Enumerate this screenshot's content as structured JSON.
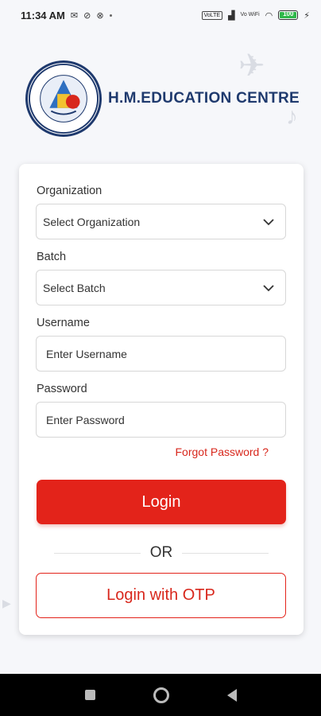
{
  "status_bar": {
    "time": "11:34 AM",
    "left_icons": [
      "mail-icon",
      "no-signal-icon",
      "block-icon"
    ],
    "right_icons": [
      "volte-icon",
      "sim-signal-icon",
      "wifi-label-icon",
      "wifi-icon",
      "battery-icon",
      "charging-icon"
    ],
    "volte_label": "VoLTE",
    "wifi_label": "Vo WiFi",
    "battery_level": "100"
  },
  "brand": {
    "title": "H.M.EDUCATION CENTRE"
  },
  "form": {
    "organization_label": "Organization",
    "organization_value": "Select Organization",
    "batch_label": "Batch",
    "batch_value": "Select Batch",
    "username_label": "Username",
    "username_placeholder": "Enter Username",
    "password_label": "Password",
    "password_placeholder": "Enter Password",
    "forgot_password": "Forgot Password ?",
    "login_button": "Login",
    "or_text": "OR",
    "otp_button": "Login with OTP"
  },
  "colors": {
    "accent": "#e3231a",
    "brand": "#1f3a6e"
  },
  "nav_bar": {
    "buttons": [
      "recent-apps-icon",
      "home-icon",
      "back-icon"
    ]
  }
}
